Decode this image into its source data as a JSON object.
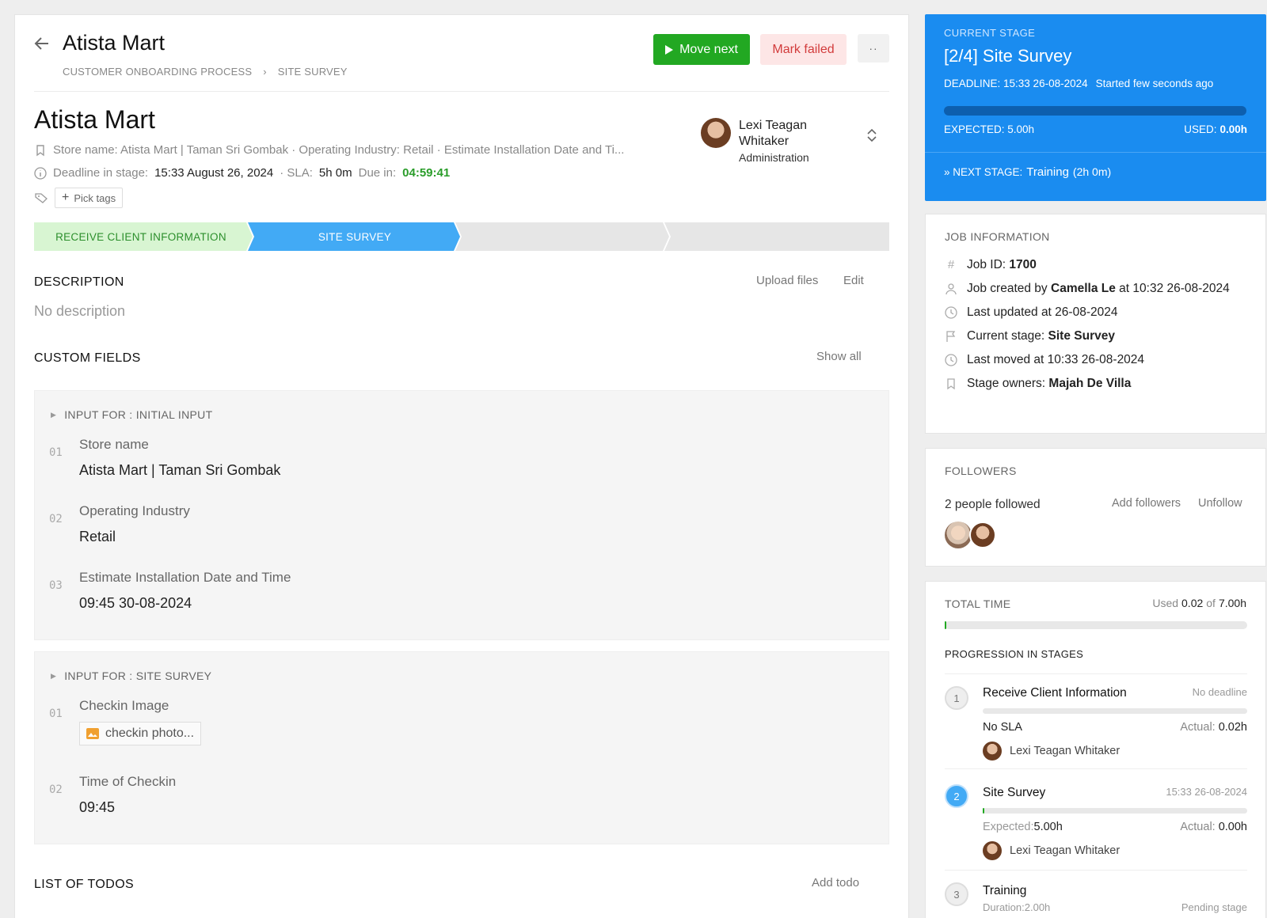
{
  "header": {
    "title": "Atista Mart",
    "breadcrumb": [
      "CUSTOMER ONBOARDING PROCESS",
      "SITE SURVEY"
    ],
    "move_next_label": "Move next",
    "mark_failed_label": "Mark failed",
    "more_label": "··"
  },
  "job": {
    "title": "Atista Mart",
    "summary": "Store name: Atista Mart | Taman Sri Gombak · Operating Industry: Retail · Estimate Installation Date and Ti...",
    "deadline_label": "Deadline in stage:",
    "deadline_value": "15:33 August 26, 2024",
    "sla_label": "· SLA:",
    "sla_value": "5h 0m",
    "due_label": "Due in:",
    "due_value": "04:59:41",
    "pick_tags_label": "Pick tags",
    "assignee_name": "Lexi Teagan Whitaker",
    "assignee_role": "Administration"
  },
  "stages": [
    {
      "label": "RECEIVE CLIENT INFORMATION",
      "state": "done"
    },
    {
      "label": "SITE SURVEY",
      "state": "current"
    },
    {
      "label": "",
      "state": "pending"
    },
    {
      "label": "",
      "state": "pending"
    }
  ],
  "description": {
    "title": "DESCRIPTION",
    "upload_label": "Upload files",
    "edit_label": "Edit",
    "empty_text": "No description"
  },
  "custom_fields": {
    "title": "CUSTOM FIELDS",
    "show_all_label": "Show all",
    "groups": [
      {
        "heading": "INPUT FOR : INITIAL INPUT",
        "items": [
          {
            "num": "01",
            "label": "Store name",
            "value": "Atista Mart | Taman Sri Gombak"
          },
          {
            "num": "02",
            "label": "Operating Industry",
            "value": "Retail"
          },
          {
            "num": "03",
            "label": "Estimate Installation Date and Time",
            "value": "09:45 30-08-2024"
          }
        ]
      },
      {
        "heading": "INPUT FOR : SITE SURVEY",
        "items": [
          {
            "num": "01",
            "label": "Checkin Image",
            "file": "checkin photo..."
          },
          {
            "num": "02",
            "label": "Time of Checkin",
            "value": "09:45"
          }
        ]
      }
    ]
  },
  "todos": {
    "title": "LIST OF TODOS",
    "add_label": "Add todo"
  },
  "current_stage": {
    "caption": "CURRENT STAGE",
    "title": "[2/4] Site Survey",
    "deadline": "DEADLINE: 15:33 26-08-2024",
    "started": "Started few seconds ago",
    "expected": "EXPECTED: 5.00h",
    "used_label": "USED:",
    "used_value": "0.00h",
    "progress_fraction": 0.0,
    "next_label": "» NEXT STAGE:",
    "next_value": "Training",
    "next_duration": "(2h 0m)"
  },
  "job_information": {
    "title": "JOB INFORMATION",
    "job_id_label": "Job ID:",
    "job_id": "1700",
    "created_prefix": "Job created by",
    "created_by": "Camella Le",
    "created_suffix": "at 10:32 26-08-2024",
    "last_updated": "Last updated at 26-08-2024",
    "current_stage_label": "Current stage:",
    "current_stage_value": "Site Survey",
    "last_moved": "Last moved at 10:33 26-08-2024",
    "owners_label": "Stage owners:",
    "owners_value": "Majah De Villa"
  },
  "followers": {
    "title": "FOLLOWERS",
    "count_text": "2 people followed",
    "add_label": "Add followers",
    "unfollow_label": "Unfollow"
  },
  "total_time": {
    "title": "TOTAL TIME",
    "used_prefix": "Used",
    "used": "0.02",
    "of_text": "of",
    "total": "7.00h",
    "progress_fraction": 0.003,
    "progression_title": "PROGRESSION IN STAGES",
    "steps": [
      {
        "num": "1",
        "name": "Receive Client Information",
        "right": "No deadline",
        "left_label": "No SLA",
        "actual_label": "Actual:",
        "actual": "0.02h",
        "owner": "Lexi Teagan Whitaker",
        "progress": 0.0
      },
      {
        "num": "2",
        "name": "Site Survey",
        "right": "15:33 26-08-2024",
        "left_label": "Expected:",
        "left_value": "5.00h",
        "actual_label": "Actual:",
        "actual": "0.00h",
        "owner": "Lexi Teagan Whitaker",
        "progress": 0.005
      },
      {
        "num": "3",
        "name": "Training",
        "left_label": "Duration:",
        "left_value": "2.00h",
        "right": "Pending stage"
      }
    ]
  },
  "colors": {
    "accent_green": "#22a822",
    "fail_red": "#d23b3b",
    "stage_blue": "#1a8cf0",
    "done_green_bg": "#d8f5d2"
  }
}
